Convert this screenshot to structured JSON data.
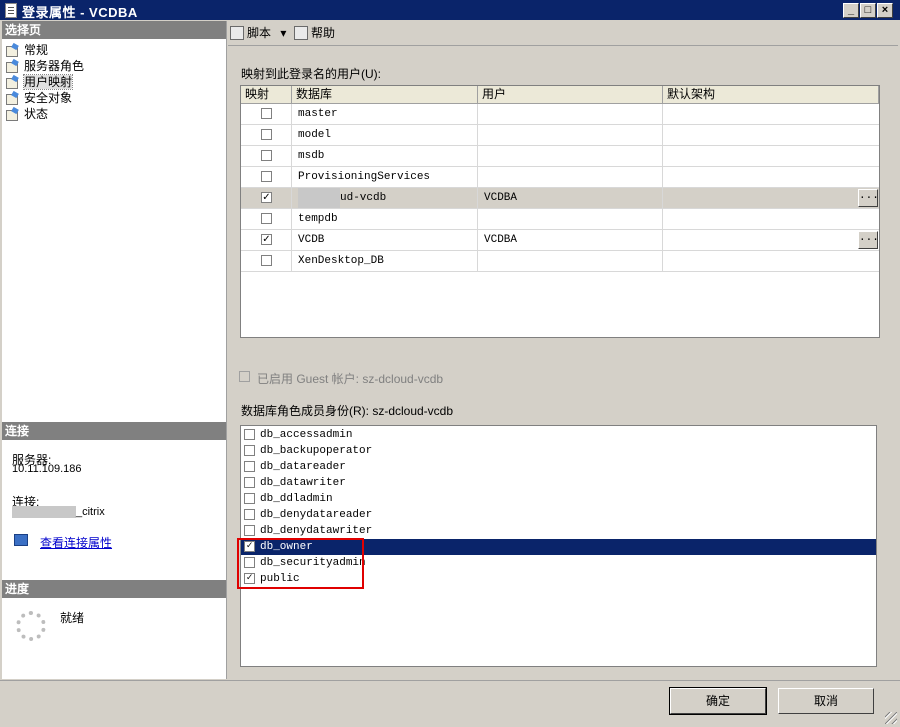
{
  "window": {
    "title": "登录属性 - VCDBA",
    "min": "_",
    "max": "□",
    "close": "×"
  },
  "left": {
    "select_page_header": "选择页",
    "nav": [
      {
        "label": "常规"
      },
      {
        "label": "服务器角色"
      },
      {
        "label": "用户映射"
      },
      {
        "label": "安全对象"
      },
      {
        "label": "状态"
      }
    ],
    "connection_header": "连接",
    "server_label": "服务器:",
    "server_value": "10.11.109.186",
    "connect_label": "连接:",
    "connect_value": "_citrix",
    "view_props_link": "查看连接属性",
    "progress_header": "进度",
    "progress_status": "就绪"
  },
  "toolbar": {
    "script_label": "脚本",
    "script_arrow": "▾",
    "help_label": "帮助"
  },
  "mapping": {
    "label": "映射到此登录名的用户(U):",
    "columns": [
      "映射",
      "数据库",
      "用户",
      "默认架构"
    ],
    "rows": [
      {
        "mapped": false,
        "db": "master",
        "user": "",
        "schema": ""
      },
      {
        "mapped": false,
        "db": "model",
        "user": "",
        "schema": ""
      },
      {
        "mapped": false,
        "db": "msdb",
        "user": "",
        "schema": ""
      },
      {
        "mapped": false,
        "db": "ProvisioningServices",
        "user": "",
        "schema": ""
      },
      {
        "mapped": true,
        "db": "ud-vcdb",
        "user": "VCDBA",
        "schema": ""
      },
      {
        "mapped": false,
        "db": "tempdb",
        "user": "",
        "schema": ""
      },
      {
        "mapped": true,
        "db": "VCDB",
        "user": "VCDBA",
        "schema": ""
      },
      {
        "mapped": false,
        "db": "XenDesktop_DB",
        "user": "",
        "schema": ""
      }
    ],
    "ellipsis": "..."
  },
  "guest": {
    "label": "已启用 Guest 帐户: sz-dcloud-vcdb"
  },
  "roles": {
    "label": "数据库角色成员身份(R): sz-dcloud-vcdb",
    "items": [
      {
        "name": "db_accessadmin",
        "checked": false
      },
      {
        "name": "db_backupoperator",
        "checked": false
      },
      {
        "name": "db_datareader",
        "checked": false
      },
      {
        "name": "db_datawriter",
        "checked": false
      },
      {
        "name": "db_ddladmin",
        "checked": false
      },
      {
        "name": "db_denydatareader",
        "checked": false
      },
      {
        "name": "db_denydatawriter",
        "checked": false
      },
      {
        "name": "db_owner",
        "checked": true
      },
      {
        "name": "db_securityadmin",
        "checked": false
      },
      {
        "name": "public",
        "checked": true
      }
    ]
  },
  "buttons": {
    "ok": "确定",
    "cancel": "取消"
  },
  "check_glyph": "✓"
}
